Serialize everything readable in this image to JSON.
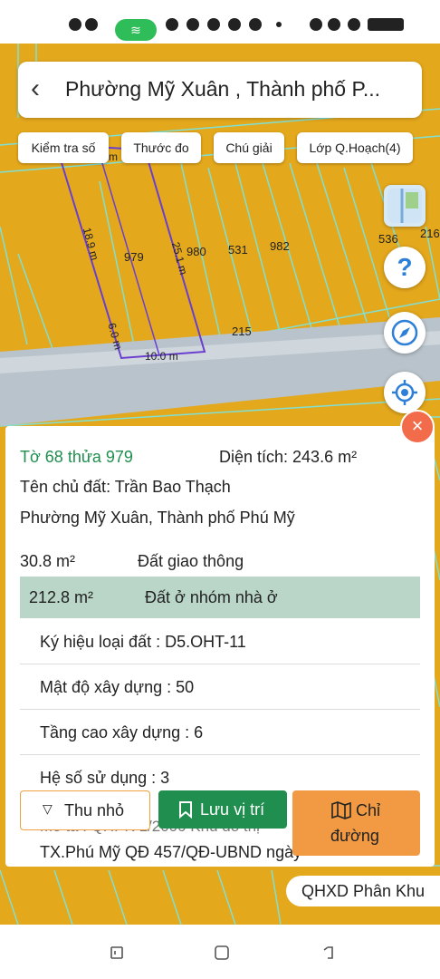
{
  "header": {
    "title": "Phường Mỹ Xuân , Thành phố P..."
  },
  "toolbar": {
    "check_label": "Kiểm tra số",
    "ruler_label": "Thước đo",
    "legend_label": "Chú giải",
    "layer_label": "Lớp Q.Hoạch(4)"
  },
  "map": {
    "plots": [
      "979",
      "980",
      "531",
      "982",
      "215",
      "536",
      "216"
    ],
    "measures": [
      "18.9 m",
      "25.1 m",
      "6.0 m",
      "10.0 m",
      "m"
    ]
  },
  "fab": {
    "help": "?",
    "close": "×"
  },
  "parcel": {
    "sheet_plot": "Tờ 68 thửa 979",
    "area": "Diện tích: 243.6 m²",
    "owner": "Tên chủ đất: Trần Bao Thạch",
    "address": "Phường Mỹ Xuân, Thành phố Phú Mỹ",
    "usage1_area": "30.8 m²",
    "usage1_type": "Đất giao thông",
    "usage2_area": "212.8 m²",
    "usage2_type": "Đất ở nhóm nhà ở",
    "rows": [
      "Ký hiệu loại đất : D5.OHT-11",
      "Mật độ xây dựng : 50",
      "Tầng cao xây dựng : 6",
      "Hệ số sử dụng : 3"
    ],
    "desc_partial": "Mô tả : QHPK 1/2000 Khu đô thị",
    "desc_line2": "TX.Phú Mỹ QĐ 457/QĐ-UBND ngày"
  },
  "actions": {
    "collapse": "Thu nhỏ",
    "save": "Lưu vị trí",
    "route_line1": "Chỉ",
    "route_line2": "đường"
  },
  "badge": {
    "qhxd": "QHXD Phân Khu"
  },
  "colors": {
    "map_bg": "#e4a81c",
    "road": "#b9c3cb",
    "save": "#1f8e4e",
    "route": "#f19a43",
    "close": "#f26b4a",
    "highlight": "#b9d6c9"
  }
}
